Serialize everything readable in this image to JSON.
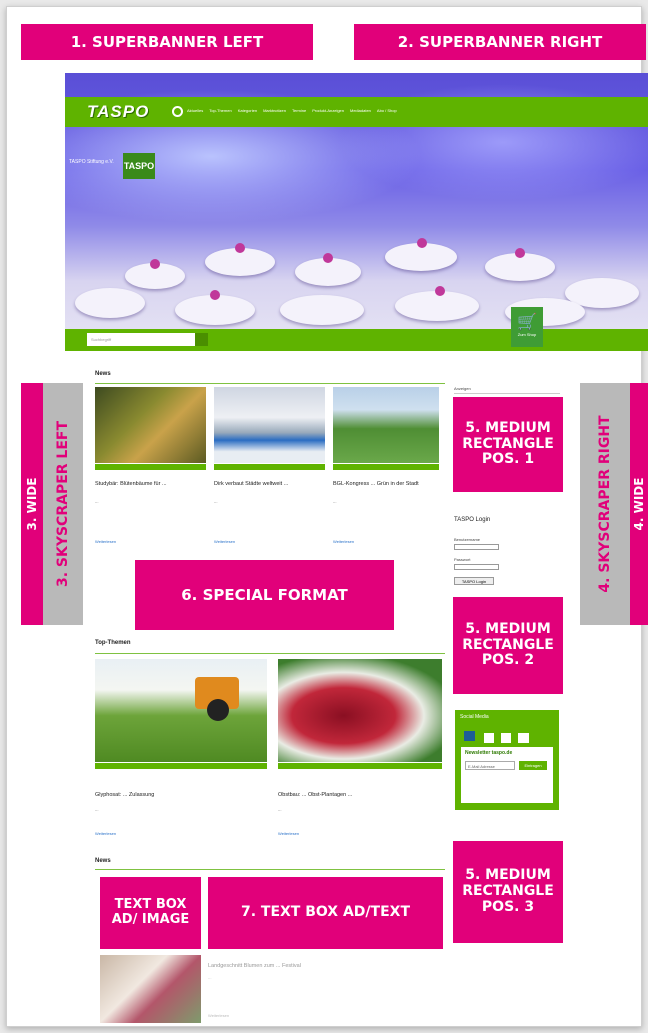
{
  "ad_labels": {
    "superbanner_left": "1. SUPERBANNER LEFT",
    "superbanner_right": "2. SUPERBANNER RIGHT",
    "wide_left": "3. WIDE",
    "skyscraper_left": "3. SKYSCRAPER LEFT",
    "skyscraper_right": "4. SKYSCRAPER RIGHT",
    "wide_right": "4. WIDE",
    "medium_rectangle_1": "5. MEDIUM RECTANGLE POS. 1",
    "medium_rectangle_2": "5. MEDIUM RECTANGLE POS. 2",
    "medium_rectangle_3": "5. MEDIUM RECTANGLE POS. 3",
    "special_format": "6. SPECIAL FORMAT",
    "text_box_image": "TEXT BOX AD/ IMAGE",
    "text_box_text": "7. TEXT BOX AD/TEXT"
  },
  "site": {
    "logo": "TASPO",
    "nav": [
      "Aktuelles",
      "Top-Themen",
      "Kategorien",
      "Marktnotizen",
      "Termine",
      "Produkt-Anzeigen",
      "Mediadaten",
      "Abo / Shop"
    ],
    "hero_sign": "TASPO Stiftung e.V.",
    "search_placeholder": "Suchbegriff",
    "cart_label": "Zum Shop"
  },
  "news": {
    "heading": "News",
    "items": [
      {
        "title": "Studybär: Blütenbäume für ...",
        "text": "..."
      },
      {
        "title": "Dirk verbaut Städte weltweit ...",
        "text": "..."
      },
      {
        "title": "BGL-Kongress ... Grün in der Stadt",
        "text": "..."
      }
    ],
    "more": "Weiterlesen"
  },
  "sidebar": {
    "anzeigen": "Anzeigen",
    "login_title": "TASPO Login",
    "user_label": "Benutzername",
    "pass_label": "Passwort",
    "login_button": "TASPO Login",
    "social_title": "Social Media",
    "newsletter_title": "Newsletter taspo.de",
    "email_placeholder": "E-Mail Adresse",
    "subscribe": "Eintragen"
  },
  "top_themen": {
    "heading": "Top-Themen",
    "items": [
      {
        "title": "Glyphosat: ... Zulassung",
        "text": "..."
      },
      {
        "title": "Obstbau: ... Obst-Plantagen ...",
        "text": "..."
      }
    ]
  },
  "news2": {
    "heading": "News",
    "item_title": "Landgeschnitt Blumen zum ... Festival",
    "item_text": "..."
  },
  "colors": {
    "ad_accent": "#e1007a",
    "site_green": "#5fb300",
    "placeholder_gray": "#b9b9b9"
  }
}
